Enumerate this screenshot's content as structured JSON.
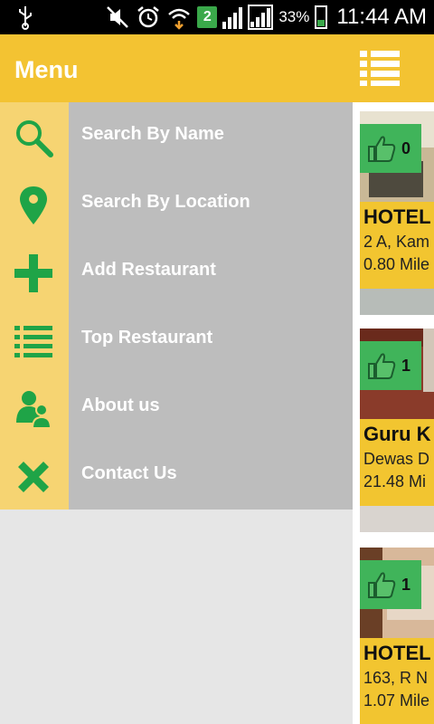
{
  "status_bar": {
    "notification_badge": "2",
    "battery_percent": "33%",
    "time": "11:44 AM"
  },
  "header": {
    "title": "Menu",
    "list_icon": "list-icon"
  },
  "menu": {
    "items": [
      {
        "label": "Search By Name",
        "icon": "search-icon"
      },
      {
        "label": "Search By Location",
        "icon": "location-pin-icon"
      },
      {
        "label": "Add Restaurant",
        "icon": "plus-icon"
      },
      {
        "label": "Top Restaurant",
        "icon": "list-icon"
      },
      {
        "label": "About us",
        "icon": "people-icon"
      },
      {
        "label": "Contact Us",
        "icon": "close-x-icon"
      }
    ]
  },
  "restaurants": [
    {
      "name": "HOTEL",
      "address": "2 A, Kam",
      "distance": "0.80 Mile",
      "likes": "0"
    },
    {
      "name": "Guru K",
      "address": "Dewas D",
      "distance": "21.48 Mi",
      "likes": "1"
    },
    {
      "name": "HOTEL",
      "address": "163, R N",
      "distance": "1.07 Mile",
      "likes": "1"
    }
  ],
  "colors": {
    "header_yellow": "#f3c332",
    "icon_green": "#1fa447",
    "drawer_gray": "#bdbdbd",
    "drawer_strip": "#f6d472"
  }
}
